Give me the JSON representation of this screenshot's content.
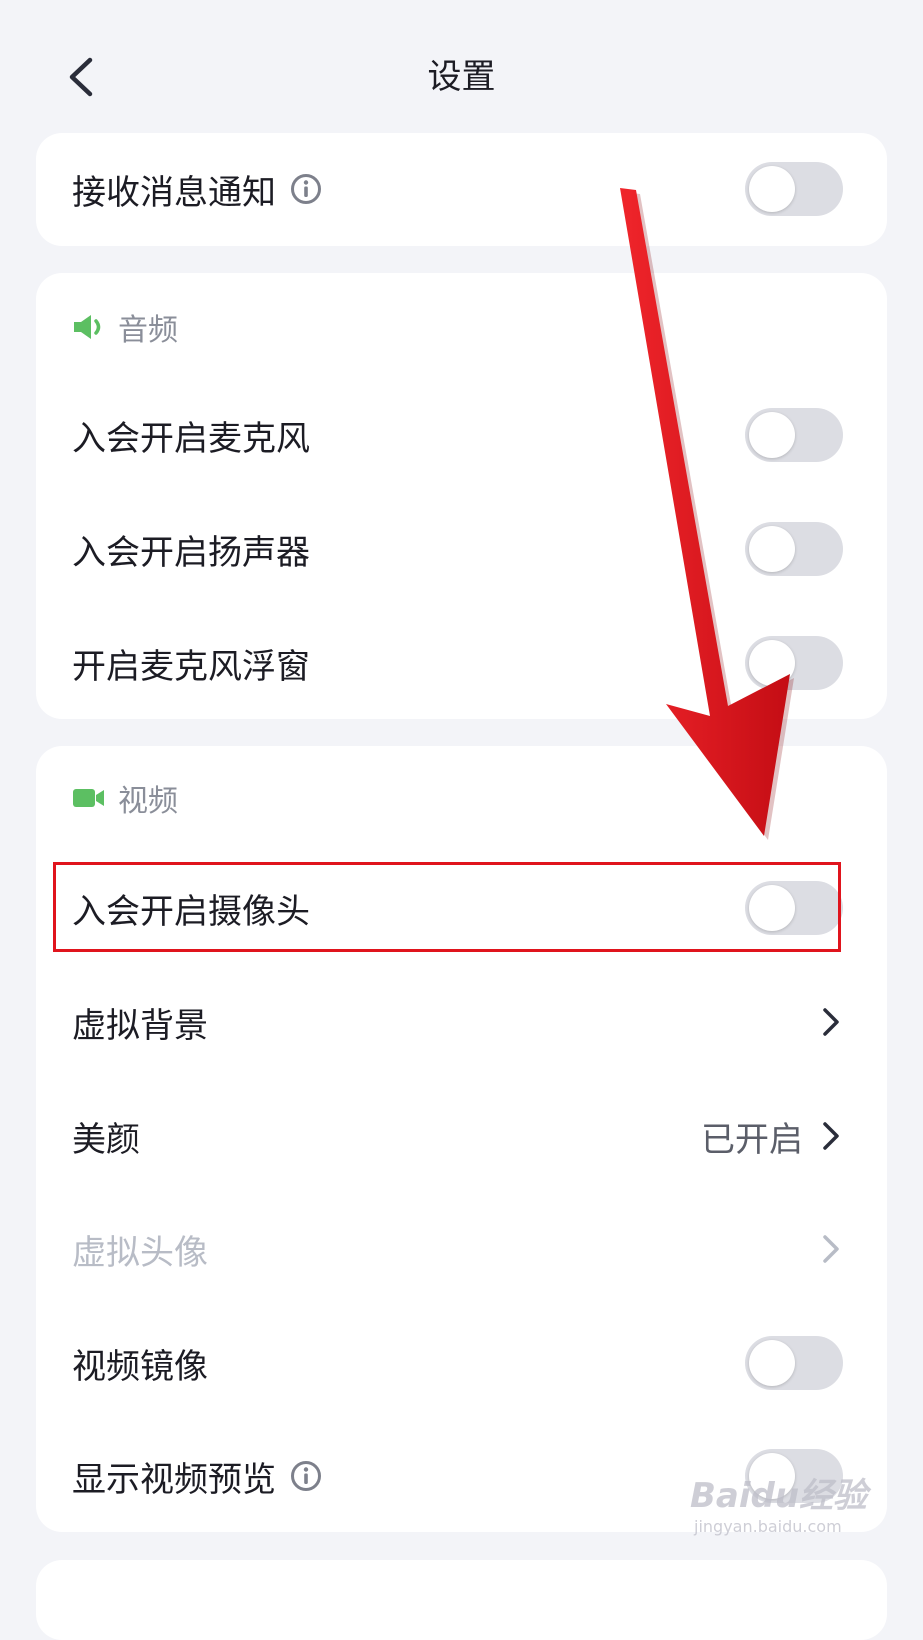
{
  "header": {
    "title": "设置",
    "back_icon": "chevron-left-icon"
  },
  "notifications": {
    "label": "接收消息通知",
    "info_icon": "info-icon",
    "enabled": false
  },
  "audio": {
    "section_title": "音频",
    "section_icon": "speaker-icon",
    "items": [
      {
        "label": "入会开启麦克风",
        "enabled": false
      },
      {
        "label": "入会开启扬声器",
        "enabled": false
      },
      {
        "label": "开启麦克风浮窗",
        "enabled": false
      }
    ]
  },
  "video": {
    "section_title": "视频",
    "section_icon": "video-camera-icon",
    "camera": {
      "label": "入会开启摄像头",
      "enabled": false
    },
    "virtual_background": {
      "label": "虚拟背景"
    },
    "beauty": {
      "label": "美颜",
      "value": "已开启"
    },
    "virtual_avatar": {
      "label": "虚拟头像",
      "disabled": true
    },
    "mirror": {
      "label": "视频镜像",
      "enabled": false
    },
    "preview": {
      "label": "显示视频预览",
      "info_icon": "info-icon",
      "enabled": false
    }
  },
  "annotations": {
    "arrow_color": "#e0141d",
    "highlight_color": "#e0141d"
  },
  "colors": {
    "background": "#f3f4f8",
    "card": "#ffffff",
    "accent_green": "#5cbf62",
    "toggle_off": "#dcdde3"
  },
  "watermark": {
    "brand": "Baidu经验",
    "url": "jingyan.baidu.com"
  }
}
